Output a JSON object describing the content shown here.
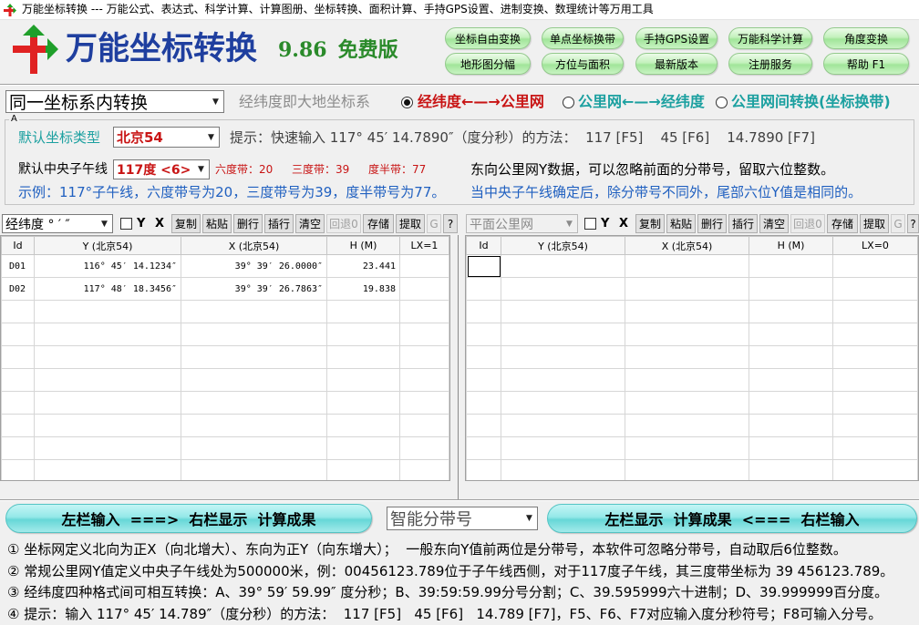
{
  "window": {
    "title": "万能坐标转换 --- 万能公式、表达式、科学计算、计算图册、坐标转换、面积计算、手持GPS设置、进制变换、数理统计等万用工具",
    "icon": "app-cross-icon"
  },
  "header": {
    "logo": "cross-arrows-logo",
    "app_name": "万能坐标转换",
    "version": "9.86",
    "edition": "免费版",
    "buttons_row1": [
      "坐标自由变换",
      "单点坐标换带",
      "手持GPS设置",
      "万能科学计算",
      "角度变换"
    ],
    "buttons_row2": [
      "地形图分幅",
      "方位与面积",
      "最新版本",
      "注册服务",
      "帮助 F1"
    ]
  },
  "mode": {
    "conversion_type": "同一坐标系内转换",
    "note": "经纬度即大地坐标系",
    "radios": [
      {
        "label": "经纬度←—→公里网",
        "checked": true
      },
      {
        "label": "公里网←—→经纬度",
        "checked": false
      },
      {
        "label": "公里网间转换(坐标换带)",
        "checked": false
      }
    ]
  },
  "settings": {
    "group_label": "A",
    "coord_type_label": "默认坐标类型",
    "coord_type": "北京54",
    "quick_input_hint": "提示：快速输入 117° 45′ 14.7890″（度分秒）的方法：  117 [F5]    45 [F6]    14.7890 [F7]",
    "meridian_label": "默认中央子午线",
    "meridian": "117度 <6>",
    "six_degree_zone": "六度带：20",
    "three_degree_zone": "三度带：39",
    "half_degree_zone": "度半带：77",
    "east_note": "东向公里网Y数据，可以忽略前面的分带号，留取六位整数。",
    "example": "示例：117°子午线，六度带号为20，三度带号为39，度半带号为77。",
    "example_note": "当中央子午线确定后，除分带号不同外，尾部六位Y值是相同的。"
  },
  "left_panel": {
    "format": "经纬度 ° ′ ″",
    "yx_label": "Y X",
    "buttons": [
      "复制",
      "粘贴",
      "删行",
      "插行",
      "清空",
      "回退0",
      "存储",
      "提取",
      "G",
      "?"
    ],
    "columns": [
      "Id",
      "Y (北京54)",
      "X (北京54)",
      "H (M)",
      "LX=1"
    ],
    "rows": [
      [
        "D01",
        "116° 45′ 14.1234″",
        "39° 39′ 26.0000″",
        "23.441"
      ],
      [
        "D02",
        "117° 48′ 18.3456″",
        "39° 39′ 26.7863″",
        "19.838"
      ]
    ]
  },
  "right_panel": {
    "format": "平面公里网",
    "yx_label": "Y X",
    "buttons": [
      "复制",
      "粘贴",
      "删行",
      "插行",
      "清空",
      "回退0",
      "存储",
      "提取",
      "G",
      "?"
    ],
    "columns": [
      "Id",
      "Y (北京54)",
      "X (北京54)",
      "H (M)",
      "LX=0"
    ]
  },
  "bottom": {
    "left_to_right": "左栏输入  ===>  右栏显示  计算成果",
    "zone_mode": "智能分带号",
    "right_to_left": "左栏显示  计算成果  <===  右栏输入"
  },
  "notes": [
    "① 坐标网定义北向为正X（向北增大）、东向为正Y（向东增大）；  一般东向Y值前两位是分带号，本软件可忽略分带号，自动取后6位整数。",
    "② 常规公里网Y值定义中央子午线处为500000米，例：00456123.789位于子午线西侧，对于117度子午线，其三度带坐标为 39 456123.789。",
    "③ 经纬度四种格式间可相互转换：A、39° 59′ 59.99″ 度分秒；B、39:59:59.99分号分割；C、39.595999六十进制；D、39.999999百分度。",
    "④ 提示：输入 117° 45′ 14.789″（度分秒）的方法：  117 [F5]   45 [F6]   14.789 [F7]，F5、F6、F7对应输入度分秒符号；F8可输入分号。"
  ],
  "colors": {
    "title_blue": "#1f3f9f",
    "version_green": "#2a8a2a",
    "accent_red": "#c81414",
    "teal": "#1ca0a0",
    "example_blue": "#2060c0"
  }
}
